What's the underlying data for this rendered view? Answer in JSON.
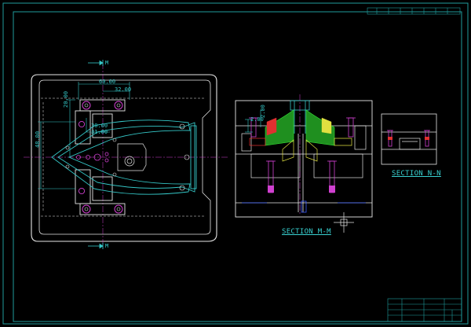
{
  "drawing": {
    "dims": {
      "outer": "60.00",
      "inner": "32.00",
      "small_a": "30.00",
      "small_b": "31.00",
      "left_vertical": "20.00",
      "left_outer": "48.00",
      "section_small_a": "2.00",
      "section_small_b": "2.00"
    },
    "section_markers": {
      "top": "M",
      "bottom": "M"
    },
    "section_labels": {
      "m": "SECTION M-M",
      "n": "SECTION N-N"
    }
  },
  "title_block": {
    "rows": [
      "",
      "",
      "",
      ""
    ]
  },
  "colors": {
    "background": "#000000",
    "border": "#1f9d9d",
    "outline": "#e6e6e6",
    "cyan": "#35c8c8",
    "green": "#22b822",
    "magenta": "#d040d0",
    "red": "#e03030",
    "yellow": "#e0e040",
    "blue": "#3a5cff"
  }
}
